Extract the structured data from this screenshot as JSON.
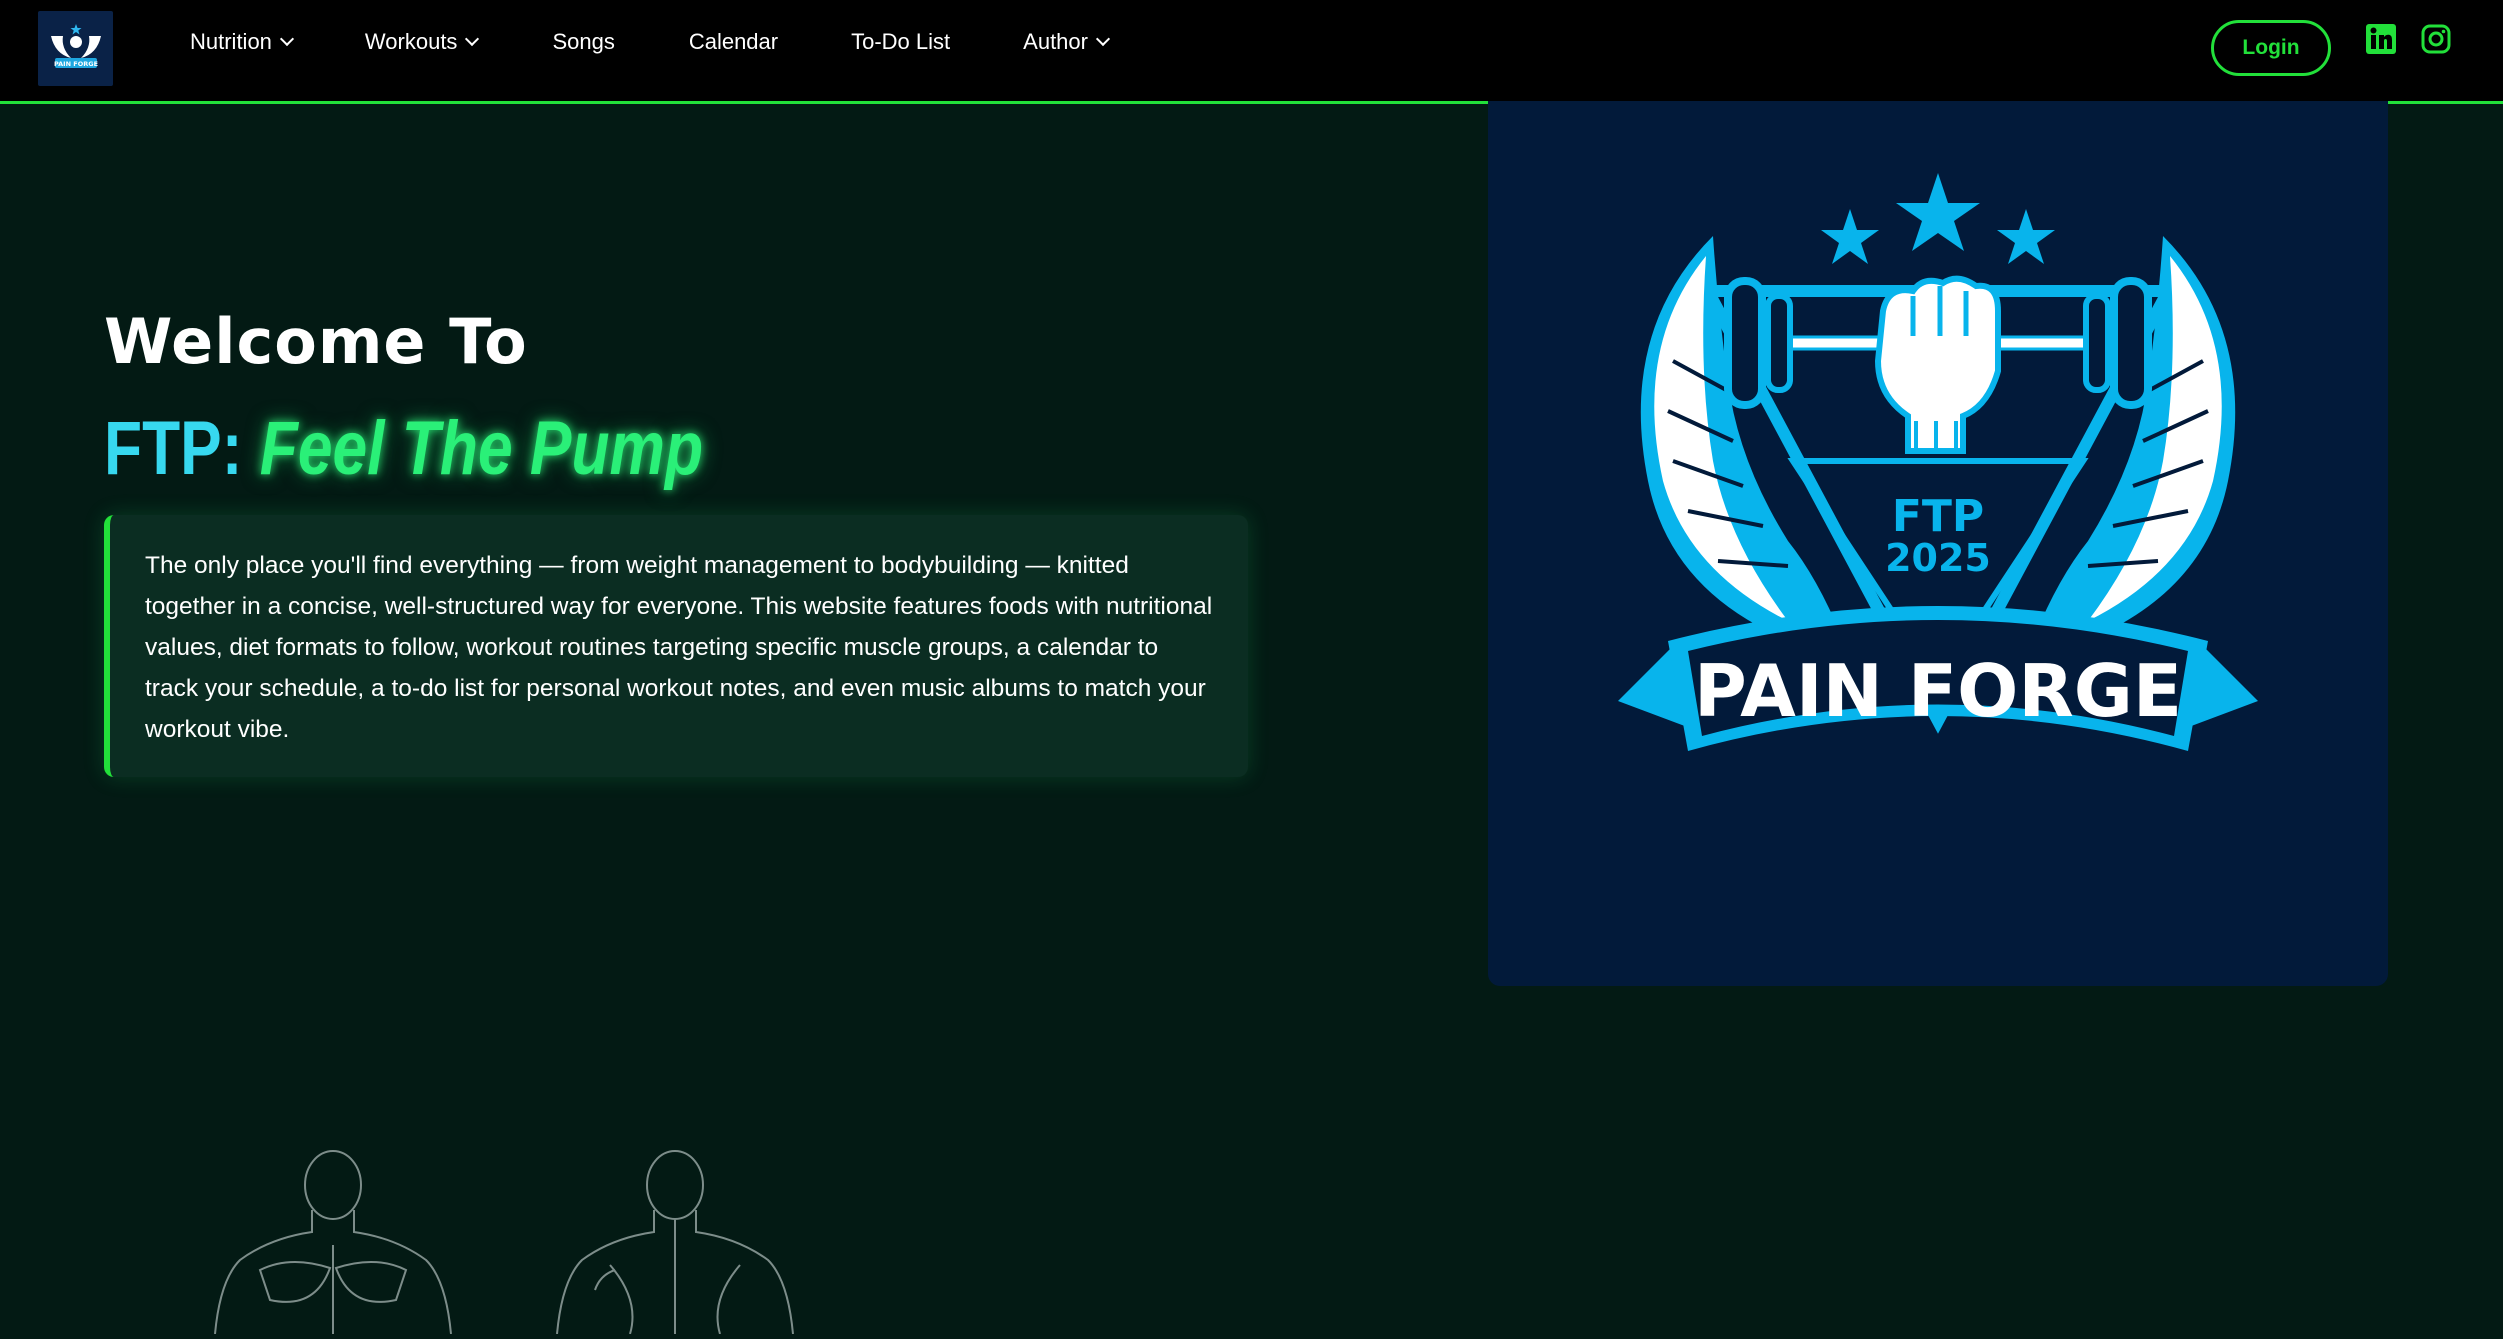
{
  "brand": {
    "logo_small_text": "PAIN FORGE"
  },
  "nav": {
    "items": [
      {
        "label": "Nutrition",
        "has_dropdown": true
      },
      {
        "label": "Workouts",
        "has_dropdown": true
      },
      {
        "label": "Songs",
        "has_dropdown": false
      },
      {
        "label": "Calendar",
        "has_dropdown": false
      },
      {
        "label": "To-Do List",
        "has_dropdown": false
      },
      {
        "label": "Author",
        "has_dropdown": true
      }
    ],
    "login_label": "Login",
    "social_icons": [
      "linkedin-icon",
      "instagram-icon"
    ]
  },
  "hero": {
    "welcome": "Welcome To",
    "ftp_prefix": "FTP:",
    "tagline": "Feel The Pump",
    "intro": "The only place you'll find everything — from weight management to bodybuilding — knitted together in a concise, well-structured way for everyone. This website features foods with nutritional values, diet formats to follow, workout routines targeting specific muscle groups, a calendar to track your schedule, a to-do list for personal workout notes, and even music albums to match your workout vibe.",
    "emblem": {
      "ftp": "FTP",
      "year": "2025",
      "banner": "PAIN FORGE"
    }
  },
  "colors": {
    "accent_green": "#22e03a",
    "neon_green": "#2af078",
    "cyan": "#37d8ef",
    "background": "#031a14",
    "emblem_blue": "#08b4ec",
    "emblem_bg": "#021a3a"
  }
}
